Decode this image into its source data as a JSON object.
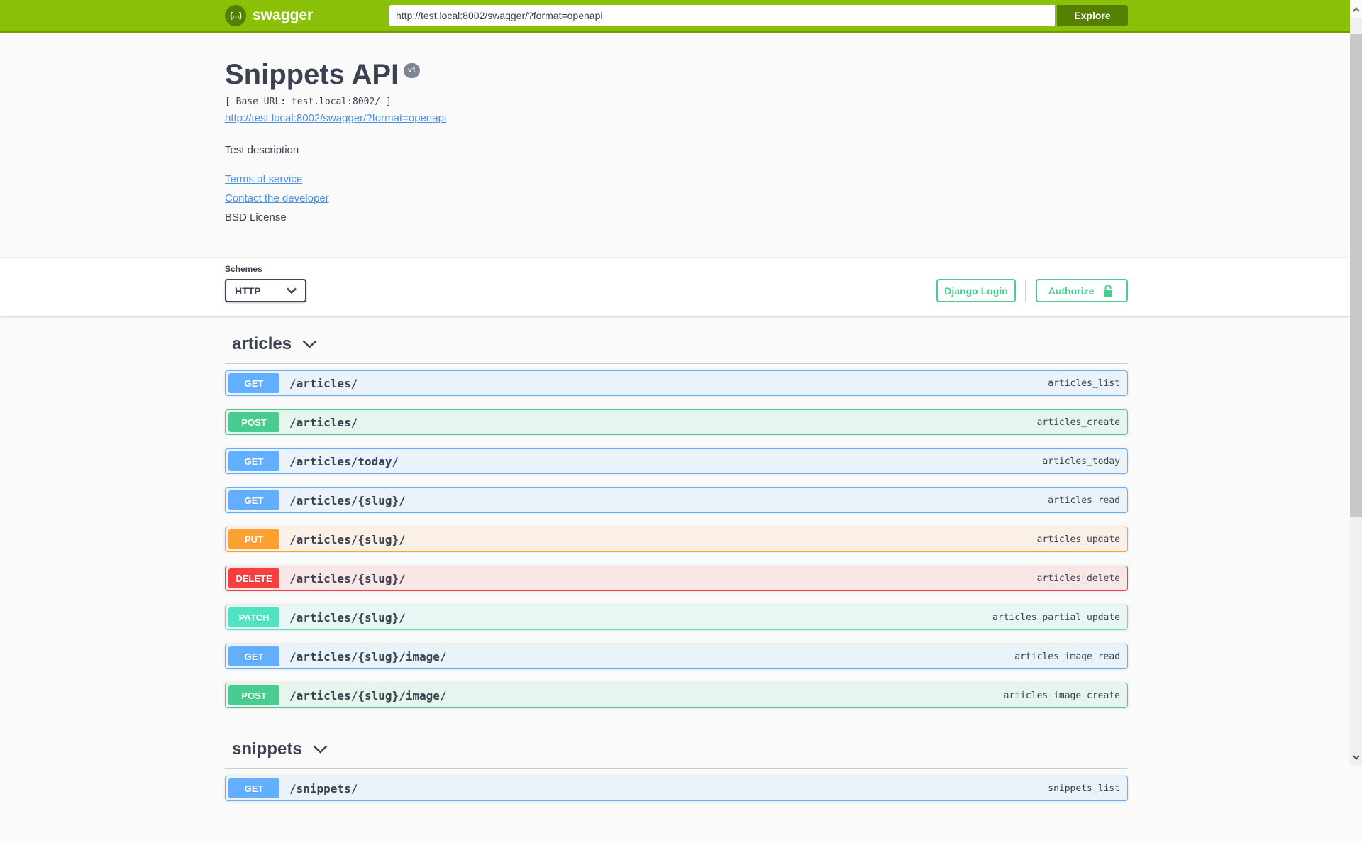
{
  "topbar": {
    "logo_text": "swagger",
    "logo_glyph": "{…}",
    "url_value": "http://test.local:8002/swagger/?format=openapi",
    "explore_label": "Explore"
  },
  "info": {
    "title": "Snippets API",
    "version_badge": "v1",
    "base_url_line": "[ Base URL: test.local:8002/ ]",
    "spec_link": "http://test.local:8002/swagger/?format=openapi",
    "description": "Test description",
    "terms_link": "Terms of service",
    "contact_link": "Contact the developer",
    "license_text": "BSD License"
  },
  "schemes": {
    "label": "Schemes",
    "selected": "HTTP"
  },
  "auth": {
    "django_login_label": "Django Login",
    "authorize_label": "Authorize"
  },
  "sections": [
    {
      "name": "articles",
      "operations": [
        {
          "method": "GET",
          "path": "/articles/",
          "operation_id": "articles_list"
        },
        {
          "method": "POST",
          "path": "/articles/",
          "operation_id": "articles_create"
        },
        {
          "method": "GET",
          "path": "/articles/today/",
          "operation_id": "articles_today"
        },
        {
          "method": "GET",
          "path": "/articles/{slug}/",
          "operation_id": "articles_read"
        },
        {
          "method": "PUT",
          "path": "/articles/{slug}/",
          "operation_id": "articles_update"
        },
        {
          "method": "DELETE",
          "path": "/articles/{slug}/",
          "operation_id": "articles_delete"
        },
        {
          "method": "PATCH",
          "path": "/articles/{slug}/",
          "operation_id": "articles_partial_update"
        },
        {
          "method": "GET",
          "path": "/articles/{slug}/image/",
          "operation_id": "articles_image_read"
        },
        {
          "method": "POST",
          "path": "/articles/{slug}/image/",
          "operation_id": "articles_image_create"
        }
      ]
    },
    {
      "name": "snippets",
      "operations": [
        {
          "method": "GET",
          "path": "/snippets/",
          "operation_id": "snippets_list"
        }
      ]
    }
  ],
  "colors": {
    "topbar_bg": "#8ac007",
    "explore_bg": "#547f00",
    "link_blue": "#4990e2",
    "text_dark": "#3b4151",
    "auth_green": "#49cc90",
    "methods": {
      "GET": {
        "badge": "#61affe",
        "row_bg": "rgba(97,175,254,0.1)"
      },
      "POST": {
        "badge": "#49cc90",
        "row_bg": "rgba(73,204,144,0.1)"
      },
      "PUT": {
        "badge": "#fca130",
        "row_bg": "rgba(252,161,48,0.1)"
      },
      "DELETE": {
        "badge": "#f93e3e",
        "row_bg": "rgba(249,62,62,0.1)"
      },
      "PATCH": {
        "badge": "#50e3c2",
        "row_bg": "rgba(80,227,194,0.1)"
      }
    }
  }
}
